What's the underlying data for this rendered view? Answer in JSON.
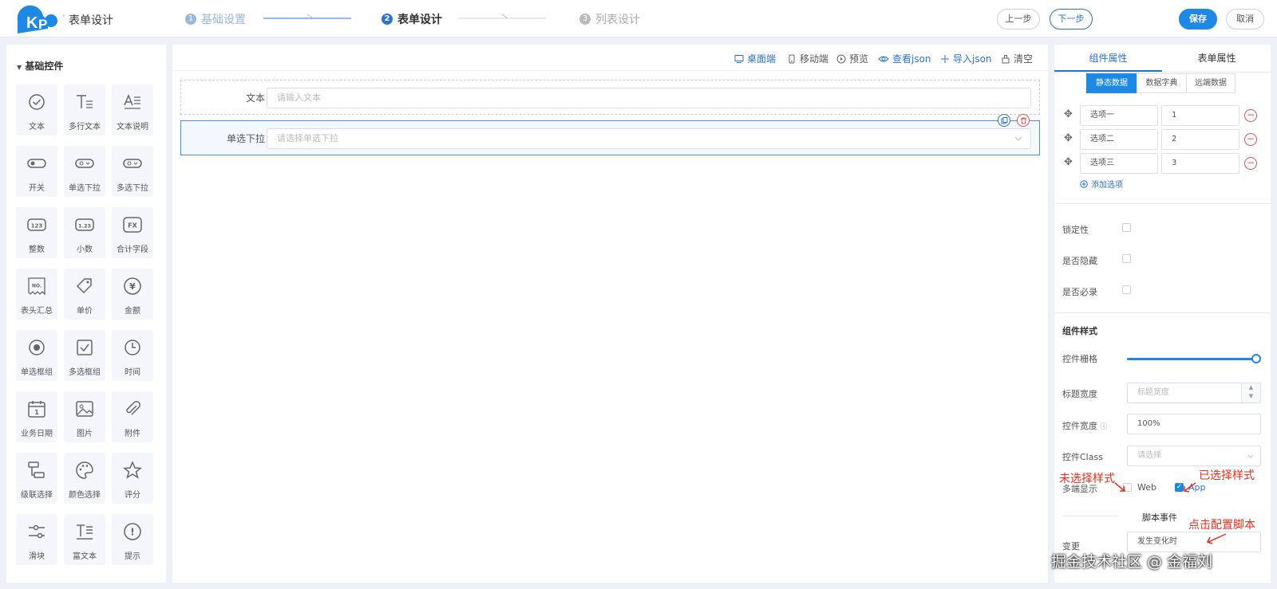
{
  "header": {
    "app_title": "表单设计",
    "steps": [
      {
        "num": "1",
        "label": "基础设置"
      },
      {
        "num": "2",
        "label": "表单设计"
      },
      {
        "num": "3",
        "label": "列表设计"
      }
    ],
    "prev_label": "上一步",
    "next_label": "下一步",
    "save_label": "保存",
    "cancel_label": "取消",
    "colors": {
      "primary": "#1e88e5",
      "accent": "#2b74c9"
    }
  },
  "palette": {
    "section_title": "基础控件",
    "widgets": [
      {
        "label": "文本",
        "icon": "check-circle-icon"
      },
      {
        "label": "多行文本",
        "icon": "multiline-text-icon"
      },
      {
        "label": "文本说明",
        "icon": "text-description-icon"
      },
      {
        "label": "开关",
        "icon": "toggle-icon"
      },
      {
        "label": "单选下拉",
        "icon": "single-select-icon"
      },
      {
        "label": "多选下拉",
        "icon": "multi-select-icon"
      },
      {
        "label": "整数",
        "icon": "integer-icon",
        "glyph": "123"
      },
      {
        "label": "小数",
        "icon": "decimal-icon",
        "glyph": "1.23"
      },
      {
        "label": "合计字段",
        "icon": "formula-icon",
        "glyph": "FX"
      },
      {
        "label": "表头汇总",
        "icon": "number-tag-icon",
        "glyph": "NO."
      },
      {
        "label": "单价",
        "icon": "price-tag-icon"
      },
      {
        "label": "金额",
        "icon": "yen-icon",
        "glyph": "¥"
      },
      {
        "label": "单选框组",
        "icon": "radio-icon"
      },
      {
        "label": "多选框组",
        "icon": "checkbox-icon"
      },
      {
        "label": "时间",
        "icon": "clock-icon"
      },
      {
        "label": "业务日期",
        "icon": "calendar-icon",
        "glyph": "1"
      },
      {
        "label": "图片",
        "icon": "image-icon"
      },
      {
        "label": "附件",
        "icon": "paperclip-icon"
      },
      {
        "label": "级联选择",
        "icon": "cascade-icon"
      },
      {
        "label": "颜色选择",
        "icon": "palette-icon"
      },
      {
        "label": "评分",
        "icon": "star-icon"
      },
      {
        "label": "滑块",
        "icon": "slider-icon"
      },
      {
        "label": "富文本",
        "icon": "rich-text-icon"
      },
      {
        "label": "提示",
        "icon": "alert-icon",
        "glyph": "!"
      }
    ]
  },
  "canvas": {
    "toolbar": [
      {
        "label": "桌面端",
        "icon": "desktop-icon"
      },
      {
        "label": "移动端",
        "icon": "mobile-icon"
      },
      {
        "label": "预览",
        "icon": "play-icon"
      },
      {
        "label": "查看json",
        "icon": "eye-icon"
      },
      {
        "label": "导入json",
        "icon": "plus-icon"
      },
      {
        "label": "清空",
        "icon": "clear-icon"
      }
    ],
    "fields": [
      {
        "label": "文本",
        "placeholder": "请输入文本"
      },
      {
        "label": "单选下拉",
        "placeholder": "请选择单选下拉"
      }
    ]
  },
  "props": {
    "tabs": [
      "组件属性",
      "表单属性"
    ],
    "source_tabs": [
      "静态数据",
      "数据字典",
      "远端数据"
    ],
    "options": [
      {
        "label": "选项一",
        "value": "1"
      },
      {
        "label": "选项二",
        "value": "2"
      },
      {
        "label": "选项三",
        "value": "3"
      }
    ],
    "add_option": "添加选项",
    "locked_label": "锁定性",
    "hidden_label": "是否隐藏",
    "required_label": "是否必录",
    "style_section": "组件样式",
    "grid_label": "控件栅格",
    "grid_value": 1.0,
    "title_width_label": "标题宽度",
    "title_width_placeholder": "标题宽度",
    "control_width_label": "控件宽度",
    "control_width_value": "100%",
    "class_label": "控件Class",
    "class_placeholder": "请选择",
    "multi_label": "多端显示",
    "web_label": "Web",
    "app_label": "App",
    "web_checked": false,
    "app_checked": true,
    "script_section": "脚本事件",
    "script_row_label": "变更",
    "script_row_value": "发生变化时"
  },
  "annotations": {
    "unselected": "未选择样式",
    "selected": "已选择样式",
    "script": "点击配置脚本"
  },
  "watermark": "掘金技术社区 @ 金福刘"
}
